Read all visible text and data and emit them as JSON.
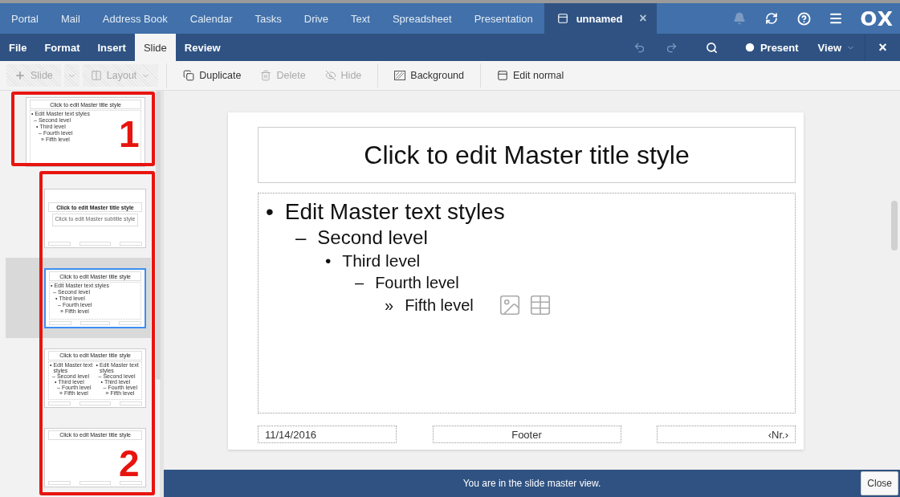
{
  "app_bar": {
    "apps": [
      {
        "label": "Portal",
        "selected": false
      },
      {
        "label": "Mail",
        "selected": false
      },
      {
        "label": "Address Book",
        "selected": false
      },
      {
        "label": "Calendar",
        "selected": false
      },
      {
        "label": "Tasks",
        "selected": false
      },
      {
        "label": "Drive",
        "selected": false
      },
      {
        "label": "Text",
        "selected": false
      },
      {
        "label": "Spreadsheet",
        "selected": false
      },
      {
        "label": "Presentation",
        "selected": false
      }
    ],
    "document_tab": {
      "label": "unnamed",
      "close": "×",
      "selected": true
    },
    "logo": "OX"
  },
  "menu_bar": {
    "tabs": [
      {
        "label": "File",
        "selected": false
      },
      {
        "label": "Format",
        "selected": false
      },
      {
        "label": "Insert",
        "selected": false
      },
      {
        "label": "Slide",
        "selected": true
      },
      {
        "label": "Review",
        "selected": false
      }
    ],
    "present": "Present",
    "view": "View",
    "close": "×"
  },
  "toolbar": [
    {
      "kind": "add",
      "label": "Slide",
      "disabled": true
    },
    {
      "kind": "layout",
      "label": "Layout",
      "disabled": true
    },
    {
      "kind": "duplicate",
      "label": "Duplicate",
      "disabled": false
    },
    {
      "kind": "delete",
      "label": "Delete",
      "disabled": true
    },
    {
      "kind": "hide",
      "label": "Hide",
      "disabled": true
    },
    {
      "kind": "background",
      "label": "Background",
      "disabled": false
    },
    {
      "kind": "edit-normal",
      "label": "Edit normal",
      "disabled": false
    }
  ],
  "slides_panel": {
    "master": {
      "kind": "master",
      "selected": false,
      "title": "Click to edit Master title style",
      "bullets": [
        {
          "marker": "•",
          "text": "Edit Master text styles",
          "children": [
            {
              "marker": "–",
              "text": "Second level",
              "children": [
                {
                  "marker": "•",
                  "text": "Third level",
                  "children": [
                    {
                      "marker": "–",
                      "text": "Fourth level",
                      "children": [
                        {
                          "marker": "»",
                          "text": "Fifth level"
                        }
                      ]
                    }
                  ]
                }
              ]
            }
          ]
        }
      ]
    },
    "layouts": [
      {
        "kind": "title",
        "selected": false,
        "title": "Click to edit Master title style",
        "subtitle": "Click to edit Master subtitle style"
      },
      {
        "kind": "content",
        "selected": true,
        "title": "Click to edit Master title style",
        "bullets": [
          {
            "marker": "•",
            "text": "Edit Master text styles",
            "children": [
              {
                "marker": "–",
                "text": "Second level",
                "children": [
                  {
                    "marker": "•",
                    "text": "Third level",
                    "children": [
                      {
                        "marker": "–",
                        "text": "Fourth level",
                        "children": [
                          {
                            "marker": "»",
                            "text": "Fifth level"
                          }
                        ]
                      }
                    ]
                  }
                ]
              }
            ]
          }
        ]
      },
      {
        "kind": "two-content",
        "selected": false,
        "title": "Click to edit Master title style",
        "columns": [
          {
            "bullets": [
              {
                "marker": "•",
                "text": "Edit Master text styles",
                "children": [
                  {
                    "marker": "–",
                    "text": "Second level",
                    "children": [
                      {
                        "marker": "•",
                        "text": "Third level",
                        "children": [
                          {
                            "marker": "–",
                            "text": "Fourth level",
                            "children": [
                              {
                                "marker": "»",
                                "text": "Fifth level"
                              }
                            ]
                          }
                        ]
                      }
                    ]
                  }
                ]
              }
            ]
          },
          {
            "bullets": [
              {
                "marker": "•",
                "text": "Edit Master text styles",
                "children": [
                  {
                    "marker": "–",
                    "text": "Second level",
                    "children": [
                      {
                        "marker": "•",
                        "text": "Third level",
                        "children": [
                          {
                            "marker": "–",
                            "text": "Fourth level",
                            "children": [
                              {
                                "marker": "»",
                                "text": "Fifth level"
                              }
                            ]
                          }
                        ]
                      }
                    ]
                  }
                ]
              }
            ]
          }
        ]
      },
      {
        "kind": "title-only",
        "selected": false,
        "title": "Click to edit Master title style"
      }
    ]
  },
  "annotations": [
    {
      "label": "1"
    },
    {
      "label": "2"
    }
  ],
  "editor": {
    "slide": {
      "kind": "content",
      "title": "Click to edit Master title style",
      "bullets": [
        {
          "marker": "•",
          "text": "Edit Master text styles",
          "children": [
            {
              "marker": "–",
              "text": "Second level",
              "children": [
                {
                  "marker": "•",
                  "text": "Third level",
                  "children": [
                    {
                      "marker": "–",
                      "text": "Fourth level",
                      "children": [
                        {
                          "marker": "»",
                          "text": "Fifth level"
                        }
                      ]
                    }
                  ]
                }
              ]
            }
          ]
        }
      ],
      "footers": [
        "11/14/2016",
        "Footer",
        "‹Nr.›"
      ]
    }
  },
  "status_bar": {
    "message": "You are in the slide master view.",
    "close": "Close"
  }
}
